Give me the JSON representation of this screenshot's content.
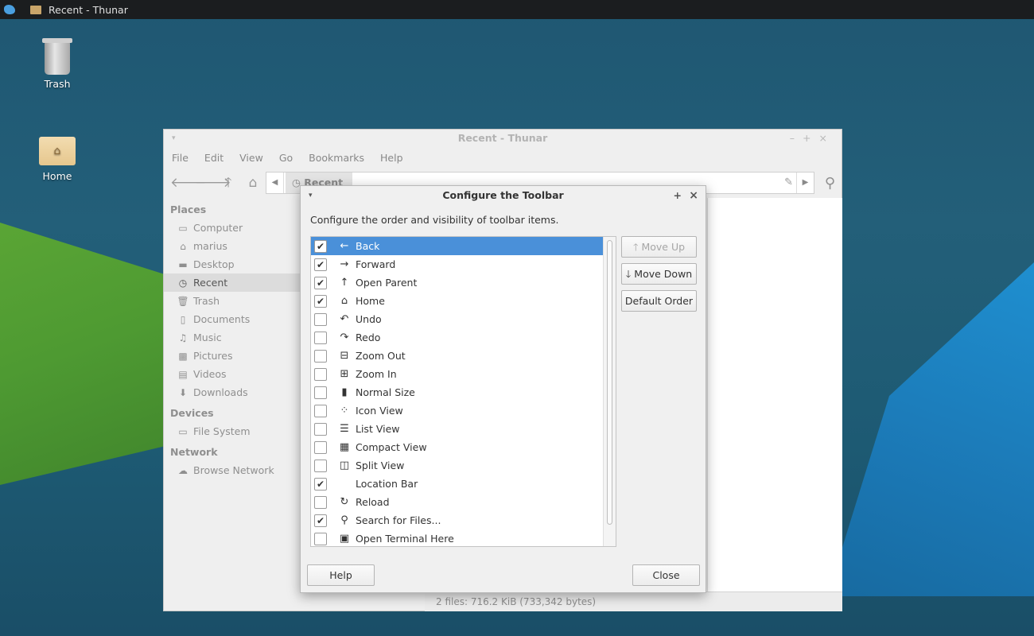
{
  "panel": {
    "task_title": "Recent - Thunar"
  },
  "desktop": {
    "trash_label": "Trash",
    "home_label": "Home"
  },
  "thunar": {
    "title": "Recent - Thunar",
    "menu": [
      "File",
      "Edit",
      "View",
      "Go",
      "Bookmarks",
      "Help"
    ],
    "location_crumb": "Recent",
    "sidebar": {
      "places_header": "Places",
      "places": [
        {
          "label": "Computer",
          "icon": "computer-icon"
        },
        {
          "label": "marius",
          "icon": "home-icon"
        },
        {
          "label": "Desktop",
          "icon": "desktop-icon"
        },
        {
          "label": "Recent",
          "icon": "clock-icon",
          "selected": true
        },
        {
          "label": "Trash",
          "icon": "trash-icon"
        },
        {
          "label": "Documents",
          "icon": "document-icon"
        },
        {
          "label": "Music",
          "icon": "music-icon"
        },
        {
          "label": "Pictures",
          "icon": "picture-icon"
        },
        {
          "label": "Videos",
          "icon": "video-icon"
        },
        {
          "label": "Downloads",
          "icon": "download-icon"
        }
      ],
      "devices_header": "Devices",
      "devices": [
        {
          "label": "File System",
          "icon": "drive-icon"
        }
      ],
      "network_header": "Network",
      "network": [
        {
          "label": "Browse Network",
          "icon": "cloud-icon"
        }
      ]
    },
    "status": "2 files: 716.2 KiB (733,342 bytes)"
  },
  "dialog": {
    "title": "Configure the Toolbar",
    "description": "Configure the order and visibility of toolbar items.",
    "items": [
      {
        "label": "Back",
        "checked": true,
        "icon": "←",
        "selected": true
      },
      {
        "label": "Forward",
        "checked": true,
        "icon": "→"
      },
      {
        "label": "Open Parent",
        "checked": true,
        "icon": "↑"
      },
      {
        "label": "Home",
        "checked": true,
        "icon": "⌂"
      },
      {
        "label": "Undo",
        "checked": false,
        "icon": "↶"
      },
      {
        "label": "Redo",
        "checked": false,
        "icon": "↷"
      },
      {
        "label": "Zoom Out",
        "checked": false,
        "icon": "⊟"
      },
      {
        "label": "Zoom In",
        "checked": false,
        "icon": "⊞"
      },
      {
        "label": "Normal Size",
        "checked": false,
        "icon": "▮"
      },
      {
        "label": "Icon View",
        "checked": false,
        "icon": "⁘"
      },
      {
        "label": "List View",
        "checked": false,
        "icon": "☰"
      },
      {
        "label": "Compact View",
        "checked": false,
        "icon": "▦"
      },
      {
        "label": "Split View",
        "checked": false,
        "icon": "◫"
      },
      {
        "label": "Location Bar",
        "checked": true,
        "icon": ""
      },
      {
        "label": "Reload",
        "checked": false,
        "icon": "↻"
      },
      {
        "label": "Search for Files...",
        "checked": true,
        "icon": "⚲"
      },
      {
        "label": "Open Terminal Here",
        "checked": false,
        "icon": "▣"
      }
    ],
    "move_up": "Move Up",
    "move_down": "Move Down",
    "default_order": "Default Order",
    "help": "Help",
    "close": "Close"
  }
}
